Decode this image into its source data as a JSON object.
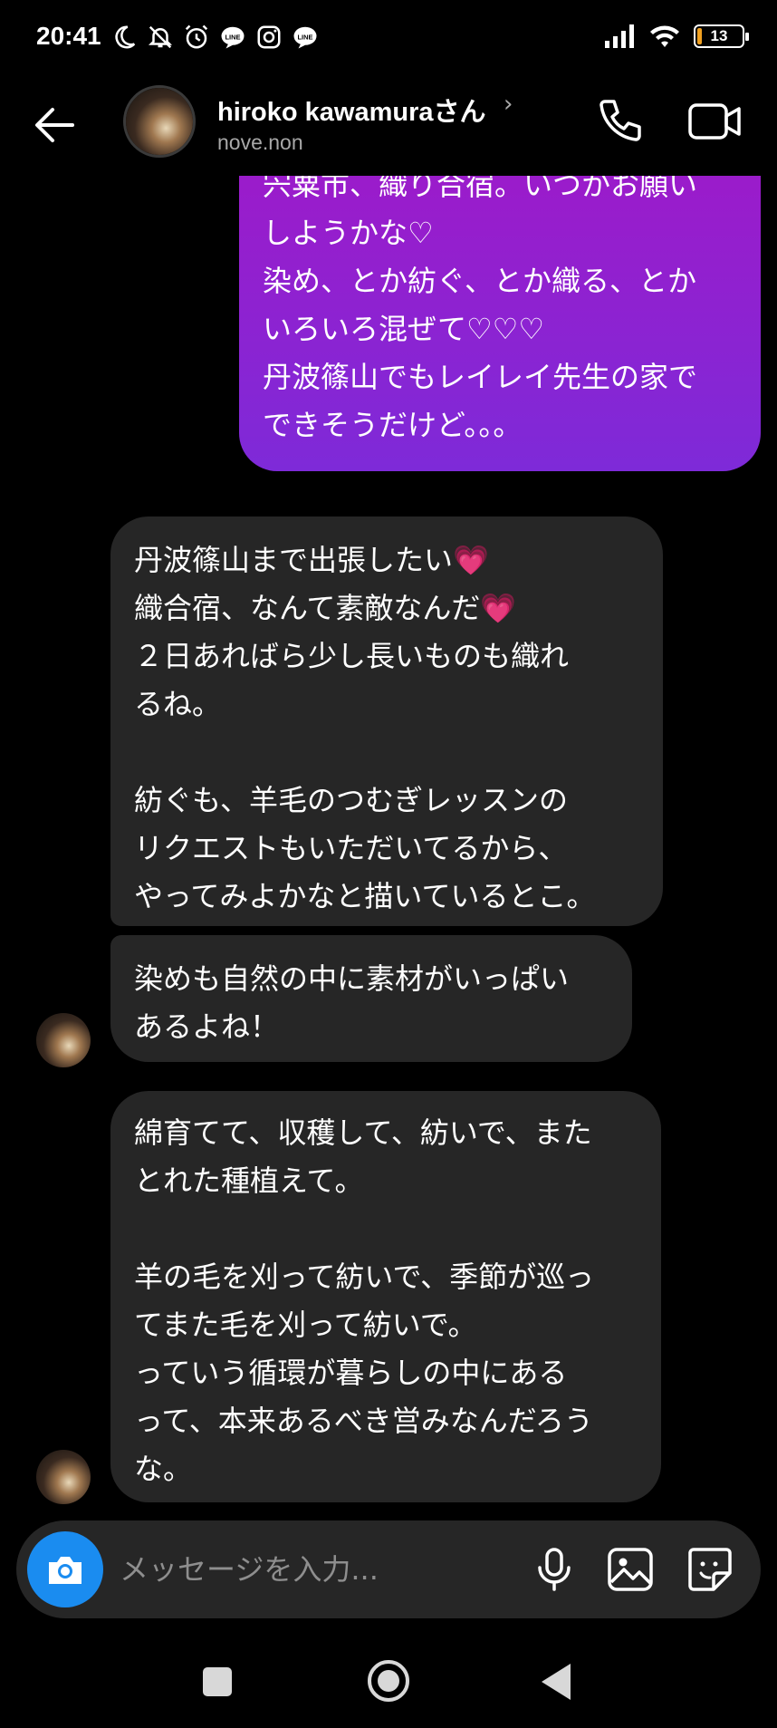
{
  "status_bar": {
    "time": "20:41",
    "icons": [
      "moon-icon",
      "bell-off-icon",
      "alarm-icon",
      "line-icon",
      "instagram-icon",
      "line-icon"
    ],
    "battery": "13"
  },
  "header": {
    "name": "hiroko kawamuraさん",
    "chevron": "›",
    "handle": "nove.non"
  },
  "messages": [
    {
      "sender": "me",
      "text": "宍粟市、織り合宿。いつかお願い\nしようかな♡\n染め、とか紡ぐ、とか織る、とか\nいろいろ混ぜて♡♡♡\n丹波篠山でもレイレイ先生の家で\nできそうだけど。。。"
    },
    {
      "sender": "them",
      "text": "丹波篠山まで出張したい💗\n織合宿、なんて素敵なんだ💗\n２日あればら少し長いものも織れ\nるね。\n\n紡ぐも、羊毛のつむぎレッスンの\nリクエストもいただいてるから、\nやってみよかなと描いているとこ。"
    },
    {
      "sender": "them",
      "text": "染めも自然の中に素材がいっぱい\nあるよね！"
    },
    {
      "sender": "them",
      "text": "綿育てて、収穫して、紡いで、また\nとれた種植えて。\n\n羊の毛を刈って紡いで、季節が巡っ\nてまた毛を刈って紡いで。\nっていう循環が暮らしの中にある\nって、本来あるべき営みなんだろう\nな。"
    }
  ],
  "composer": {
    "placeholder": "メッセージを入力..."
  },
  "colors": {
    "outgoing_top": "#a019c8",
    "outgoing_bottom": "#7e2ad8",
    "incoming": "#262626",
    "accent": "#1a8cf0"
  }
}
